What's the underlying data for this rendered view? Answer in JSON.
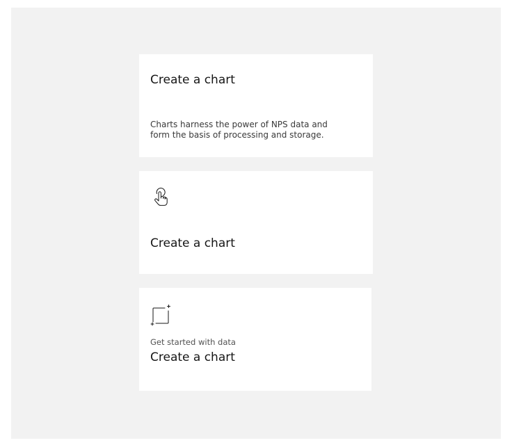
{
  "tiles": [
    {
      "title": "Create a chart",
      "description_lines": [
        "Charts harness the power of NPS data and",
        "form the basis of processing and storage."
      ]
    },
    {
      "icon": "touch-icon",
      "title": "Create a chart"
    },
    {
      "icon": "add-area-icon",
      "label": "Get started with data",
      "title": "Create a chart"
    }
  ]
}
